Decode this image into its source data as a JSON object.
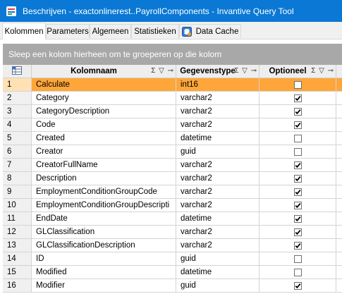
{
  "window": {
    "title": "Beschrijven - exactonlinerest..PayrollComponents - Invantive Query Tool"
  },
  "tabs": [
    {
      "label": "Kolommen",
      "active": true
    },
    {
      "label": "Parameters",
      "active": false
    },
    {
      "label": "Algemeen",
      "active": false
    },
    {
      "label": "Statistieken",
      "active": false
    },
    {
      "label": "Data Cache",
      "active": false,
      "icon": "database-icon"
    }
  ],
  "groupbar": {
    "text": "Sleep een kolom hierheen om te groeperen op die kolom"
  },
  "columns": {
    "corner_icon": "grid-select-icon",
    "name": "Kolomnaam",
    "type": "Gegevenstype",
    "optional": "Optioneel",
    "header_tools": "Σ ▽ ⊸"
  },
  "rows": [
    {
      "num": "1",
      "name": "Calculate",
      "type": "int16",
      "optional": false,
      "selected": true
    },
    {
      "num": "2",
      "name": "Category",
      "type": "varchar2",
      "optional": true
    },
    {
      "num": "3",
      "name": "CategoryDescription",
      "type": "varchar2",
      "optional": true
    },
    {
      "num": "4",
      "name": "Code",
      "type": "varchar2",
      "optional": true
    },
    {
      "num": "5",
      "name": "Created",
      "type": "datetime",
      "optional": false
    },
    {
      "num": "6",
      "name": "Creator",
      "type": "guid",
      "optional": false
    },
    {
      "num": "7",
      "name": "CreatorFullName",
      "type": "varchar2",
      "optional": true
    },
    {
      "num": "8",
      "name": "Description",
      "type": "varchar2",
      "optional": true
    },
    {
      "num": "9",
      "name": "EmploymentConditionGroupCode",
      "type": "varchar2",
      "optional": true
    },
    {
      "num": "10",
      "name": "EmploymentConditionGroupDescripti",
      "type": "varchar2",
      "optional": true
    },
    {
      "num": "11",
      "name": "EndDate",
      "type": "datetime",
      "optional": true
    },
    {
      "num": "12",
      "name": "GLClassification",
      "type": "varchar2",
      "optional": true
    },
    {
      "num": "13",
      "name": "GLClassificationDescription",
      "type": "varchar2",
      "optional": true
    },
    {
      "num": "14",
      "name": "ID",
      "type": "guid",
      "optional": false
    },
    {
      "num": "15",
      "name": "Modified",
      "type": "datetime",
      "optional": false
    },
    {
      "num": "16",
      "name": "Modifier",
      "type": "guid",
      "optional": true
    }
  ]
}
